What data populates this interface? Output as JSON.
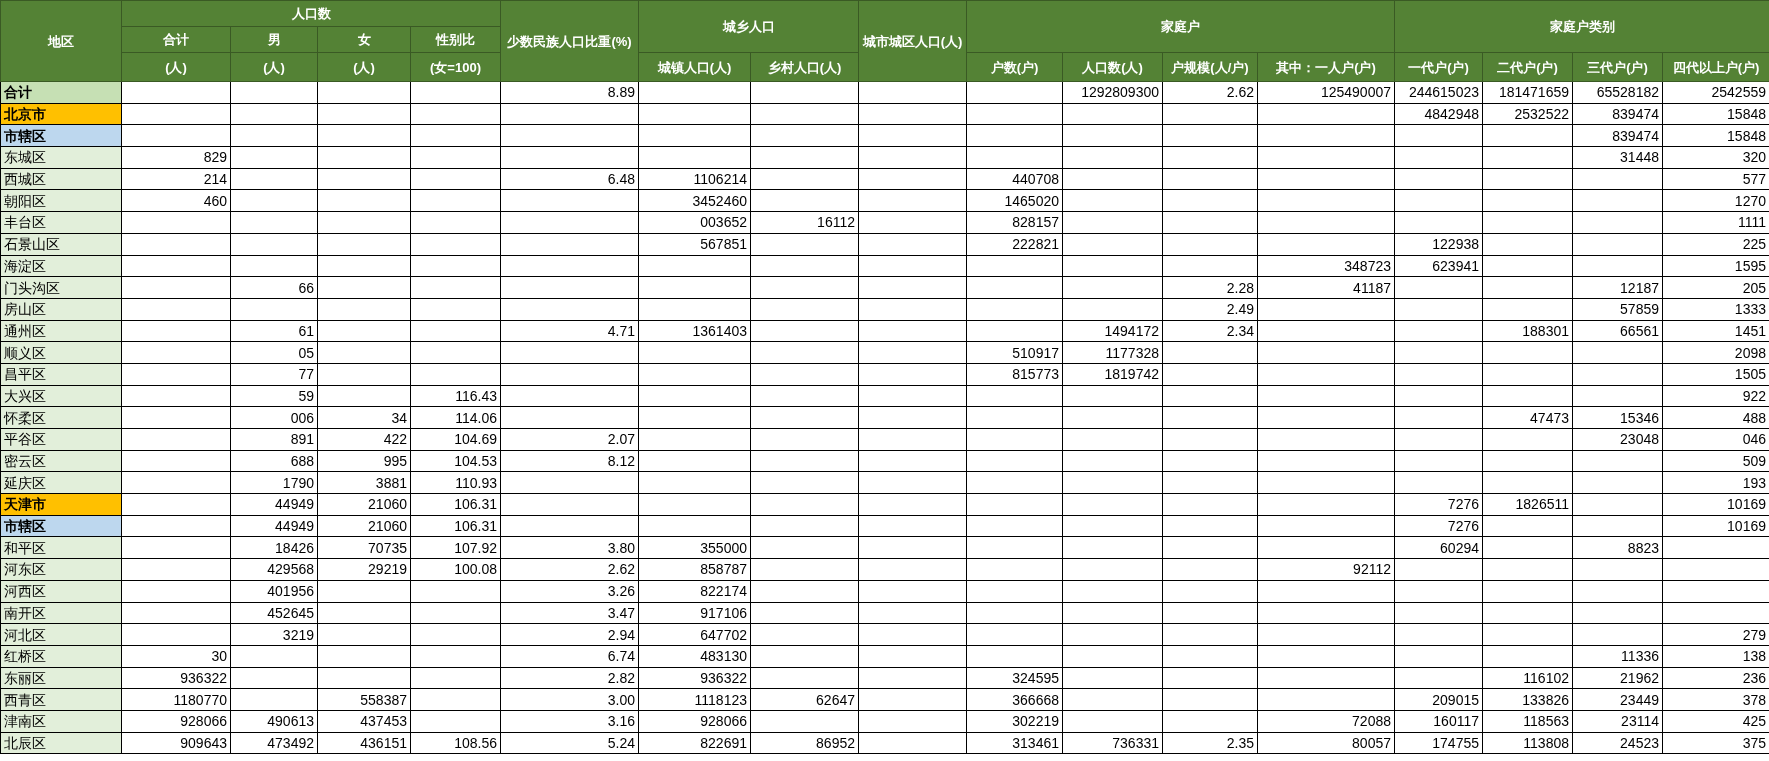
{
  "columns": [
    {
      "kind": "single",
      "label": "地区"
    },
    {
      "kind": "unit-group",
      "label": "人口数",
      "columns": [
        {
          "label": "合计",
          "unit": "(人)"
        },
        {
          "label": "男",
          "unit": "(人)"
        },
        {
          "label": "女",
          "unit": "(人)"
        },
        {
          "label": "性别比",
          "unit": "(女=100)"
        }
      ]
    },
    {
      "kind": "single",
      "label": "少数民族人口比重(%)"
    },
    {
      "kind": "group",
      "label": "城乡人口",
      "columns": [
        {
          "label": "城镇人口(人)"
        },
        {
          "label": "乡村人口(人)"
        }
      ]
    },
    {
      "kind": "single",
      "label": "城市城区人口(人)"
    },
    {
      "kind": "group",
      "label": "家庭户",
      "columns": [
        {
          "label": "户数(户)"
        },
        {
          "label": "人口数(人)"
        },
        {
          "label": "户规模(人/户)"
        },
        {
          "label": "其中：一人户(户)"
        }
      ]
    },
    {
      "kind": "group",
      "label": "家庭户类别",
      "columns": [
        {
          "label": "一代户(户)"
        },
        {
          "label": "二代户(户)"
        },
        {
          "label": "三代户(户)"
        },
        {
          "label": "四代以上户(户)"
        }
      ]
    }
  ],
  "rows": [
    {
      "kind": "total",
      "region": "合计",
      "minority_share": "8.89",
      "household_pop": "1292809300",
      "household_size": "2.62",
      "one_person": "125490007",
      "gen1": "244615023",
      "gen2": "181471659",
      "gen3": "65528182",
      "gen4": "2542559"
    },
    {
      "kind": "province",
      "region": "北京市",
      "gen1": "4842948",
      "gen2": "2532522",
      "gen3": "839474",
      "gen4": "15848"
    },
    {
      "kind": "city",
      "region": "市辖区",
      "gen3": "839474",
      "gen4": "15848"
    },
    {
      "kind": "district",
      "region": "东城区",
      "total": "829",
      "gen3": "31448",
      "gen4": "320"
    },
    {
      "kind": "district",
      "region": "西城区",
      "total": "214",
      "minority_share": "6.48",
      "urban": "1106214",
      "households": "440708",
      "gen4": "577"
    },
    {
      "kind": "district",
      "region": "朝阳区",
      "total": "460",
      "urban": "3452460",
      "households": "1465020",
      "gen4": "1270"
    },
    {
      "kind": "district",
      "region": "丰台区",
      "urban": "003652",
      "rural": "16112",
      "households": "828157",
      "gen4": "1111"
    },
    {
      "kind": "district",
      "region": "石景山区",
      "urban": "567851",
      "households": "222821",
      "gen1": "122938",
      "gen4": "225"
    },
    {
      "kind": "district",
      "region": "海淀区",
      "one_person": "348723",
      "gen1": "623941",
      "gen4": "1595"
    },
    {
      "kind": "district",
      "region": "门头沟区",
      "male": "66",
      "household_size": "2.28",
      "one_person": "41187",
      "gen3": "12187",
      "gen4": "205"
    },
    {
      "kind": "district",
      "region": "房山区",
      "household_size": "2.49",
      "gen3": "57859",
      "gen4": "1333"
    },
    {
      "kind": "district",
      "region": "通州区",
      "male": "61",
      "minority_share": "4.71",
      "urban": "1361403",
      "household_pop": "1494172",
      "household_size": "2.34",
      "gen2": "188301",
      "gen3": "66561",
      "gen4": "1451"
    },
    {
      "kind": "district",
      "region": "顺义区",
      "male": "05",
      "households": "510917",
      "household_pop": "1177328",
      "gen4": "2098"
    },
    {
      "kind": "district",
      "region": "昌平区",
      "male": "77",
      "households": "815773",
      "household_pop": "1819742",
      "gen4": "1505"
    },
    {
      "kind": "district",
      "region": "大兴区",
      "male": "59",
      "sex_ratio": "116.43",
      "gen4": "922"
    },
    {
      "kind": "district",
      "region": "怀柔区",
      "male": "006",
      "female": "34",
      "sex_ratio": "114.06",
      "gen2": "47473",
      "gen3": "15346",
      "gen4": "488"
    },
    {
      "kind": "district",
      "region": "平谷区",
      "male": "891",
      "female": "422",
      "sex_ratio": "104.69",
      "minority_share": "2.07",
      "gen3": "23048",
      "gen4": "046"
    },
    {
      "kind": "district",
      "region": "密云区",
      "male": "688",
      "female": "995",
      "sex_ratio": "104.53",
      "minority_share": "8.12",
      "gen4": "509"
    },
    {
      "kind": "district",
      "region": "延庆区",
      "male": "1790",
      "female": "3881",
      "sex_ratio": "110.93",
      "gen4": "193"
    },
    {
      "kind": "province",
      "region": "天津市",
      "male": "44949",
      "female": "21060",
      "sex_ratio": "106.31",
      "gen1": "7276",
      "gen2": "1826511",
      "gen4": "10169"
    },
    {
      "kind": "city",
      "region": "市辖区",
      "male": "44949",
      "female": "21060",
      "sex_ratio": "106.31",
      "gen1": "7276",
      "gen4": "10169"
    },
    {
      "kind": "district",
      "region": "和平区",
      "male": "18426",
      "female": "70735",
      "sex_ratio": "107.92",
      "minority_share": "3.80",
      "urban": "355000",
      "gen1": "60294",
      "gen3": "8823"
    },
    {
      "kind": "district",
      "region": "河东区",
      "male": "429568",
      "female": "29219",
      "sex_ratio": "100.08",
      "minority_share": "2.62",
      "urban": "858787",
      "one_person": "92112"
    },
    {
      "kind": "district",
      "region": "河西区",
      "male": "401956",
      "minority_share": "3.26",
      "urban": "822174"
    },
    {
      "kind": "district",
      "region": "南开区",
      "male": "452645",
      "minority_share": "3.47",
      "urban": "917106"
    },
    {
      "kind": "district",
      "region": "河北区",
      "male": "3219",
      "minority_share": "2.94",
      "urban": "647702",
      "gen4": "279"
    },
    {
      "kind": "district",
      "region": "红桥区",
      "total": "30",
      "minority_share": "6.74",
      "urban": "483130",
      "gen3": "11336",
      "gen4": "138"
    },
    {
      "kind": "district",
      "region": "东丽区",
      "total": "936322",
      "minority_share": "2.82",
      "urban": "936322",
      "households": "324595",
      "gen2": "116102",
      "gen3": "21962",
      "gen4": "236"
    },
    {
      "kind": "district",
      "region": "西青区",
      "total": "1180770",
      "female": "558387",
      "minority_share": "3.00",
      "urban": "1118123",
      "rural": "62647",
      "households": "366668",
      "gen1": "209015",
      "gen2": "133826",
      "gen3": "23449",
      "gen4": "378"
    },
    {
      "kind": "district",
      "region": "津南区",
      "total": "928066",
      "male": "490613",
      "female": "437453",
      "minority_share": "3.16",
      "urban": "928066",
      "households": "302219",
      "one_person": "72088",
      "gen1": "160117",
      "gen2": "118563",
      "gen3": "23114",
      "gen4": "425"
    },
    {
      "kind": "district",
      "region": "北辰区",
      "total": "909643",
      "male": "473492",
      "female": "436151",
      "sex_ratio": "108.56",
      "minority_share": "5.24",
      "urban": "822691",
      "rural": "86952",
      "households": "313461",
      "household_pop": "736331",
      "household_size": "2.35",
      "one_person": "80057",
      "gen1": "174755",
      "gen2": "113808",
      "gen3": "24523",
      "gen4": "375"
    }
  ]
}
